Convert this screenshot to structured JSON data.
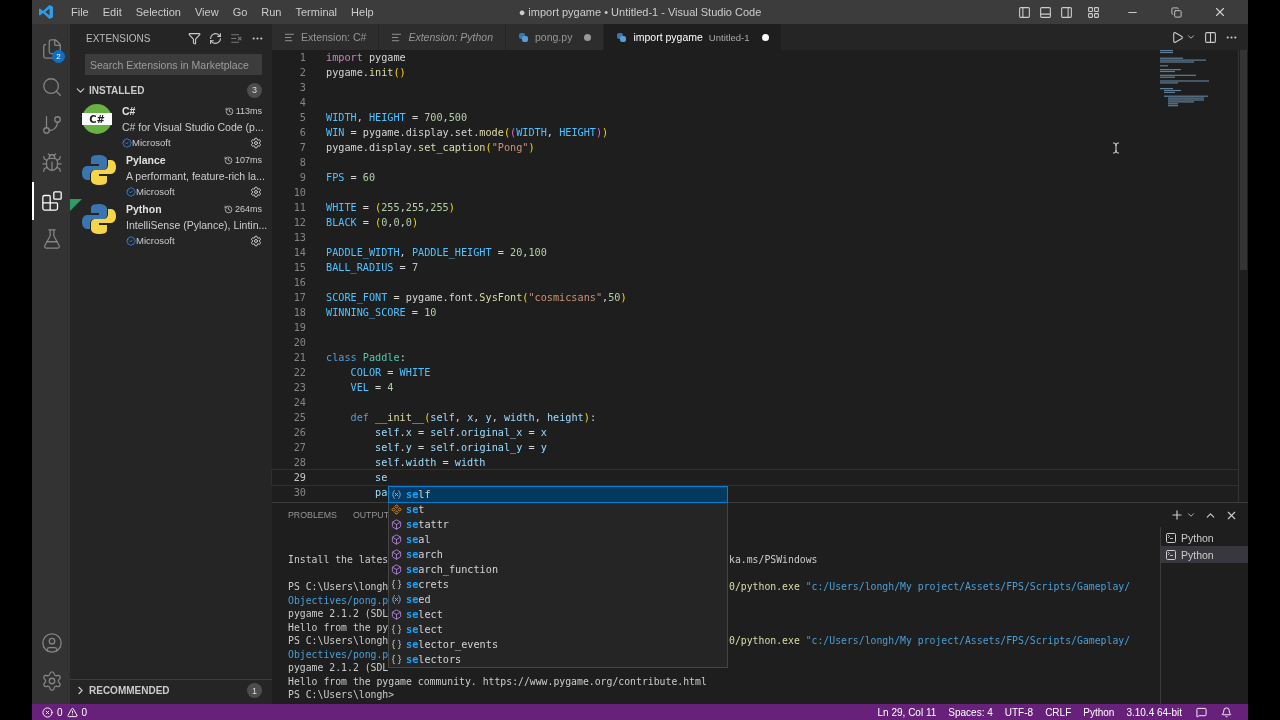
{
  "window": {
    "title": "● import pygame • Untitled-1 - Visual Studio Code"
  },
  "menu": [
    "File",
    "Edit",
    "Selection",
    "View",
    "Go",
    "Run",
    "Terminal",
    "Help"
  ],
  "activity_bar": [
    {
      "kind": "explorer",
      "badge": "2",
      "selected": false
    },
    {
      "kind": "search",
      "selected": false
    },
    {
      "kind": "source-control",
      "selected": false
    },
    {
      "kind": "run-debug",
      "selected": false
    },
    {
      "kind": "extensions",
      "selected": true
    },
    {
      "kind": "testing",
      "selected": false
    }
  ],
  "sidebar": {
    "title": "EXTENSIONS",
    "search": {
      "placeholder": "Search Extensions in Marketplace"
    },
    "installed": {
      "label": "INSTALLED",
      "count": "3",
      "expanded": true,
      "items": [
        {
          "name": "C#",
          "kind": "csharp",
          "logo_text": "C#",
          "time": "113ms",
          "description": "C# for Visual Studio Code (p...",
          "publisher": "Microsoft",
          "remote_badge": false
        },
        {
          "name": "Pylance",
          "kind": "python",
          "time": "107ms",
          "description": "A performant, feature-rich la...",
          "publisher": "Microsoft",
          "remote_badge": false
        },
        {
          "name": "Python",
          "kind": "python",
          "time": "264ms",
          "description": "IntelliSense (Pylance), Lintin...",
          "publisher": "Microsoft",
          "remote_badge": true
        }
      ]
    },
    "recommended": {
      "label": "RECOMMENDED",
      "count": "1",
      "expanded": false
    }
  },
  "tabs": [
    {
      "label": "Extension: C#",
      "kind": "doc",
      "preview": false,
      "dirty": false,
      "selected": false
    },
    {
      "label": "Extension: Python",
      "kind": "doc",
      "preview": true,
      "dirty": false,
      "selected": false
    },
    {
      "label": "pong.py",
      "kind": "python",
      "preview": false,
      "dirty": true,
      "selected": false
    },
    {
      "label": "import pygame",
      "detail": "Untitled-1",
      "kind": "python",
      "preview": false,
      "dirty": true,
      "selected": true
    }
  ],
  "editor": {
    "lines": [
      {
        "num": "1",
        "current": false,
        "tokens": [
          {
            "kind": "kw",
            "text": "import"
          },
          {
            "kind": "p",
            "text": " pygame"
          }
        ]
      },
      {
        "num": "2",
        "current": false,
        "tokens": [
          {
            "kind": "p",
            "text": "pygame."
          },
          {
            "kind": "f",
            "text": "init"
          },
          {
            "kind": "b1",
            "text": "()"
          }
        ]
      },
      {
        "num": "3",
        "current": false
      },
      {
        "num": "4",
        "current": false
      },
      {
        "num": "5",
        "current": false,
        "tokens": [
          {
            "kind": "c",
            "text": "WIDTH"
          },
          {
            "kind": "p",
            "text": ", "
          },
          {
            "kind": "c",
            "text": "HEIGHT"
          },
          {
            "kind": "p",
            "text": " = "
          },
          {
            "kind": "n",
            "text": "700"
          },
          {
            "kind": "p",
            "text": ","
          },
          {
            "kind": "n",
            "text": "500"
          }
        ]
      },
      {
        "num": "6",
        "current": false,
        "tokens": [
          {
            "kind": "c",
            "text": "WIN"
          },
          {
            "kind": "p",
            "text": " = pygame.display.set."
          },
          {
            "kind": "f",
            "text": "mode"
          },
          {
            "kind": "b1",
            "text": "("
          },
          {
            "kind": "b2",
            "text": "("
          },
          {
            "kind": "c",
            "text": "WIDTH"
          },
          {
            "kind": "p",
            "text": ", "
          },
          {
            "kind": "c",
            "text": "HEIGHT"
          },
          {
            "kind": "b2",
            "text": ")"
          },
          {
            "kind": "b1",
            "text": ")"
          }
        ]
      },
      {
        "num": "7",
        "current": false,
        "tokens": [
          {
            "kind": "p",
            "text": "pygame.display."
          },
          {
            "kind": "f",
            "text": "set_caption"
          },
          {
            "kind": "b1",
            "text": "("
          },
          {
            "kind": "s",
            "text": "\"Pong\""
          },
          {
            "kind": "b1",
            "text": ")"
          }
        ]
      },
      {
        "num": "8",
        "current": false
      },
      {
        "num": "9",
        "current": false,
        "tokens": [
          {
            "kind": "c",
            "text": "FPS"
          },
          {
            "kind": "p",
            "text": " = "
          },
          {
            "kind": "n",
            "text": "60"
          }
        ]
      },
      {
        "num": "10",
        "current": false
      },
      {
        "num": "11",
        "current": false,
        "tokens": [
          {
            "kind": "c",
            "text": "WHITE"
          },
          {
            "kind": "p",
            "text": " = "
          },
          {
            "kind": "b1",
            "text": "("
          },
          {
            "kind": "n",
            "text": "255"
          },
          {
            "kind": "p",
            "text": ","
          },
          {
            "kind": "n",
            "text": "255"
          },
          {
            "kind": "p",
            "text": ","
          },
          {
            "kind": "n",
            "text": "255"
          },
          {
            "kind": "b1",
            "text": ")"
          }
        ]
      },
      {
        "num": "12",
        "current": false,
        "tokens": [
          {
            "kind": "c",
            "text": "BLACK"
          },
          {
            "kind": "p",
            "text": " = "
          },
          {
            "kind": "b1",
            "text": "("
          },
          {
            "kind": "n",
            "text": "0"
          },
          {
            "kind": "p",
            "text": ","
          },
          {
            "kind": "n",
            "text": "0"
          },
          {
            "kind": "p",
            "text": ","
          },
          {
            "kind": "n",
            "text": "0"
          },
          {
            "kind": "b1",
            "text": ")"
          }
        ]
      },
      {
        "num": "13",
        "current": false
      },
      {
        "num": "14",
        "current": false,
        "tokens": [
          {
            "kind": "c",
            "text": "PADDLE_WIDTH"
          },
          {
            "kind": "p",
            "text": ", "
          },
          {
            "kind": "c",
            "text": "PADDLE_HEIGHT"
          },
          {
            "kind": "p",
            "text": " = "
          },
          {
            "kind": "n",
            "text": "20"
          },
          {
            "kind": "p",
            "text": ","
          },
          {
            "kind": "n",
            "text": "100"
          }
        ]
      },
      {
        "num": "15",
        "current": false,
        "tokens": [
          {
            "kind": "c",
            "text": "BALL_RADIUS"
          },
          {
            "kind": "p",
            "text": " = "
          },
          {
            "kind": "n",
            "text": "7"
          }
        ]
      },
      {
        "num": "16",
        "current": false
      },
      {
        "num": "17",
        "current": false,
        "tokens": [
          {
            "kind": "c",
            "text": "SCORE_FONT"
          },
          {
            "kind": "p",
            "text": " = pygame.font."
          },
          {
            "kind": "f",
            "text": "SysFont"
          },
          {
            "kind": "b1",
            "text": "("
          },
          {
            "kind": "s",
            "text": "\"cosmicsans\""
          },
          {
            "kind": "p",
            "text": ","
          },
          {
            "kind": "n",
            "text": "50"
          },
          {
            "kind": "b1",
            "text": ")"
          }
        ]
      },
      {
        "num": "18",
        "current": false,
        "tokens": [
          {
            "kind": "c",
            "text": "WINNING_SCORE"
          },
          {
            "kind": "p",
            "text": " = "
          },
          {
            "kind": "n",
            "text": "10"
          }
        ]
      },
      {
        "num": "19",
        "current": false
      },
      {
        "num": "20",
        "current": false
      },
      {
        "num": "21",
        "current": false,
        "tokens": [
          {
            "kind": "st",
            "text": "class "
          },
          {
            "kind": "t",
            "text": "Paddle"
          },
          {
            "kind": "p",
            "text": ":"
          }
        ]
      },
      {
        "num": "22",
        "current": false,
        "tokens": [
          {
            "kind": "c",
            "text": "    COLOR"
          },
          {
            "kind": "p",
            "text": " = "
          },
          {
            "kind": "c",
            "text": "WHITE"
          }
        ]
      },
      {
        "num": "23",
        "current": false,
        "tokens": [
          {
            "kind": "c",
            "text": "    VEL"
          },
          {
            "kind": "p",
            "text": " = "
          },
          {
            "kind": "n",
            "text": "4"
          }
        ]
      },
      {
        "num": "24",
        "current": false
      },
      {
        "num": "25",
        "current": false,
        "tokens": [
          {
            "kind": "st",
            "text": "    def "
          },
          {
            "kind": "f",
            "text": "__init__"
          },
          {
            "kind": "b1",
            "text": "("
          },
          {
            "kind": "v",
            "text": "self"
          },
          {
            "kind": "p",
            "text": ", "
          },
          {
            "kind": "v",
            "text": "x"
          },
          {
            "kind": "p",
            "text": ", "
          },
          {
            "kind": "v",
            "text": "y"
          },
          {
            "kind": "p",
            "text": ", "
          },
          {
            "kind": "v",
            "text": "width"
          },
          {
            "kind": "p",
            "text": ", "
          },
          {
            "kind": "v",
            "text": "height"
          },
          {
            "kind": "b1",
            "text": ")"
          },
          {
            "kind": "p",
            "text": ":"
          }
        ]
      },
      {
        "num": "26",
        "current": false,
        "tokens": [
          {
            "kind": "v",
            "text": "        self"
          },
          {
            "kind": "p",
            "text": "."
          },
          {
            "kind": "v",
            "text": "x"
          },
          {
            "kind": "p",
            "text": " = "
          },
          {
            "kind": "v",
            "text": "self"
          },
          {
            "kind": "p",
            "text": "."
          },
          {
            "kind": "v",
            "text": "original_x"
          },
          {
            "kind": "p",
            "text": " = "
          },
          {
            "kind": "v",
            "text": "x"
          }
        ]
      },
      {
        "num": "27",
        "current": false,
        "tokens": [
          {
            "kind": "v",
            "text": "        self"
          },
          {
            "kind": "p",
            "text": "."
          },
          {
            "kind": "v",
            "text": "y"
          },
          {
            "kind": "p",
            "text": " = "
          },
          {
            "kind": "v",
            "text": "self"
          },
          {
            "kind": "p",
            "text": "."
          },
          {
            "kind": "v",
            "text": "original_y"
          },
          {
            "kind": "p",
            "text": " = "
          },
          {
            "kind": "v",
            "text": "y"
          }
        ]
      },
      {
        "num": "28",
        "current": false,
        "tokens": [
          {
            "kind": "v",
            "text": "        self"
          },
          {
            "kind": "p",
            "text": "."
          },
          {
            "kind": "v",
            "text": "width"
          },
          {
            "kind": "p",
            "text": " = "
          },
          {
            "kind": "v",
            "text": "width"
          }
        ]
      },
      {
        "num": "29",
        "current": true,
        "tokens": [
          {
            "kind": "v",
            "text": "        se"
          }
        ]
      },
      {
        "num": "30",
        "current": false,
        "tokens": [
          {
            "kind": "v",
            "text": "        pa"
          }
        ]
      }
    ]
  },
  "suggestions": [
    {
      "match": "se",
      "rest": "lf",
      "kind": "variable",
      "selected": true
    },
    {
      "match": "se",
      "rest": "t",
      "kind": "class",
      "selected": false
    },
    {
      "match": "se",
      "rest": "tattr",
      "kind": "method",
      "selected": false
    },
    {
      "match": "se",
      "rest": "al",
      "kind": "method",
      "selected": false
    },
    {
      "match": "se",
      "rest": "arch",
      "kind": "method",
      "selected": false
    },
    {
      "match": "se",
      "rest": "arch_function",
      "kind": "method",
      "selected": false
    },
    {
      "match": "se",
      "rest": "crets",
      "kind": "module",
      "selected": false
    },
    {
      "match": "se",
      "rest": "ed",
      "kind": "variable",
      "selected": false
    },
    {
      "match": "se",
      "rest": "lect",
      "kind": "method",
      "selected": false
    },
    {
      "match": "se",
      "rest": "lect",
      "kind": "module",
      "selected": false
    },
    {
      "match": "se",
      "rest": "lector_events",
      "kind": "module",
      "selected": false
    },
    {
      "match": "se",
      "rest": "lectors",
      "kind": "module",
      "selected": false
    }
  ],
  "panel": {
    "tabs": [
      {
        "label": "PROBLEMS",
        "selected": false
      },
      {
        "label": "OUTPUT",
        "selected": false
      }
    ],
    "terminal_lines": [
      {
        "kind": "split",
        "left": "Install the lates",
        "right": [
          {
            "kind": "p",
            "text": "ka.ms/PSWindows"
          }
        ]
      },
      {
        "kind": "split",
        "left": "PS C:\\Users\\longh",
        "right": [
          {
            "kind": "y",
            "text": "0/python.exe"
          },
          {
            "kind": "b",
            "text": " \"c:/Users/longh/My project/Assets/FPS/Scripts/Gameplay/"
          }
        ]
      },
      {
        "kind": "link",
        "left": "Objectives/pong.p"
      },
      {
        "kind": "split",
        "left": "pygame 2.1.2 (SDL"
      },
      {
        "kind": "split",
        "left": "Hello from the py"
      },
      {
        "kind": "split",
        "left": "PS C:\\Users\\longh",
        "right": [
          {
            "kind": "y",
            "text": "0/python.exe"
          },
          {
            "kind": "b",
            "text": " \"c:/Users/longh/My project/Assets/FPS/Scripts/Gameplay/"
          }
        ]
      },
      {
        "kind": "link",
        "left": "Objectives/pong.p"
      },
      {
        "kind": "split",
        "left": "pygame 2.1.2 (SDL"
      },
      {
        "kind": "full",
        "full": "Hello from the pygame community. https://www.pygame.org/contribute.html"
      },
      {
        "kind": "full",
        "full": "PS C:\\Users\\longh>"
      }
    ],
    "terminals": [
      {
        "label": "Python",
        "selected": false
      },
      {
        "label": "Python",
        "selected": true
      }
    ]
  },
  "status_bar": {
    "errors": "0",
    "warnings": "0",
    "items": [
      "Ln 29, Col 11",
      "Spaces: 4",
      "UTF-8",
      "CRLF",
      "Python",
      "3.10.4 64-bit"
    ]
  }
}
